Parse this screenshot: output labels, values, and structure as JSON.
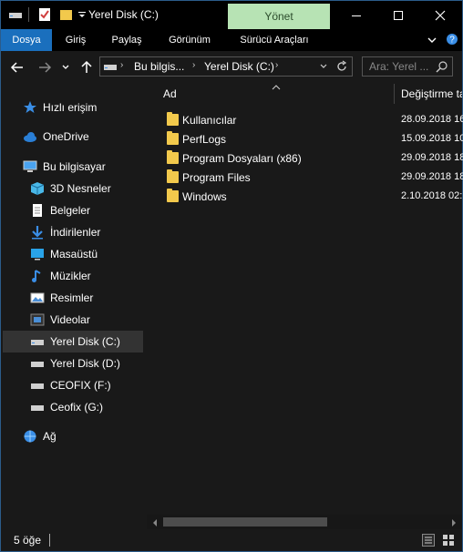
{
  "titlebar": {
    "title": "Yerel Disk (C:)",
    "context_tab": "Yönet",
    "minimize": "—",
    "maximize": "☐",
    "close": "✕"
  },
  "ribbon": {
    "tabs": [
      {
        "label": "Dosya",
        "active": true
      },
      {
        "label": "Giriş",
        "active": false
      },
      {
        "label": "Paylaş",
        "active": false
      },
      {
        "label": "Görünüm",
        "active": false
      },
      {
        "label": "Sürücü Araçları",
        "active": false
      }
    ]
  },
  "address": {
    "segments": [
      "Bu bilgis...",
      "Yerel Disk (C:)"
    ],
    "search_placeholder": "Ara: Yerel ..."
  },
  "nav": {
    "items": [
      {
        "label": "Hızlı erişim",
        "icon": "star-icon"
      },
      {
        "label": "OneDrive",
        "icon": "cloud-icon"
      },
      {
        "label": "Bu bilgisayar",
        "icon": "computer-icon"
      },
      {
        "label": "3D Nesneler",
        "icon": "cube-icon"
      },
      {
        "label": "Belgeler",
        "icon": "document-icon"
      },
      {
        "label": "İndirilenler",
        "icon": "download-icon"
      },
      {
        "label": "Masaüstü",
        "icon": "desktop-icon"
      },
      {
        "label": "Müzikler",
        "icon": "music-icon"
      },
      {
        "label": "Resimler",
        "icon": "picture-icon"
      },
      {
        "label": "Videolar",
        "icon": "video-icon"
      },
      {
        "label": "Yerel Disk (C:)",
        "icon": "drive-icon",
        "selected": true
      },
      {
        "label": "Yerel Disk (D:)",
        "icon": "drive-icon"
      },
      {
        "label": "CEOFIX (F:)",
        "icon": "drive-icon"
      },
      {
        "label": "Ceofix (G:)",
        "icon": "drive-icon"
      },
      {
        "label": "Ağ",
        "icon": "network-icon"
      }
    ]
  },
  "content": {
    "columns": {
      "name": "Ad",
      "date": "Değiştirme ta"
    },
    "files": [
      {
        "name": "Kullanıcılar",
        "date": "28.09.2018 16"
      },
      {
        "name": "PerfLogs",
        "date": "15.09.2018 10"
      },
      {
        "name": "Program Dosyaları (x86)",
        "date": "29.09.2018 18"
      },
      {
        "name": "Program Files",
        "date": "29.09.2018 18"
      },
      {
        "name": "Windows",
        "date": "2.10.2018 02:1"
      }
    ]
  },
  "status": {
    "count": "5 öğe"
  },
  "colors": {
    "accent": "#1a6fbd",
    "manage_tab": "#b7e3b4",
    "folder": "#f2c94c",
    "background": "#191919"
  }
}
